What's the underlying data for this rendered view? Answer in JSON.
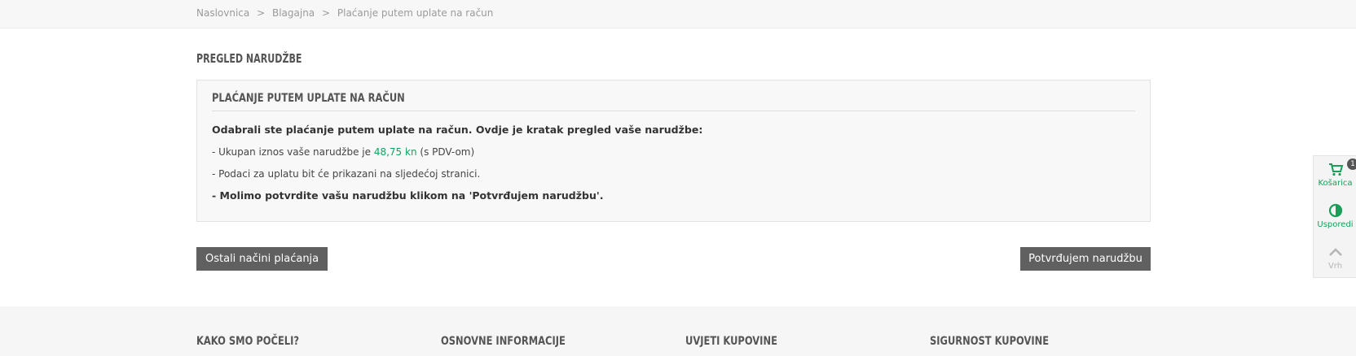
{
  "breadcrumb": {
    "items": [
      "Naslovnica",
      "Blagajna",
      "Plaćanje putem uplate na račun"
    ],
    "separator": ">"
  },
  "page": {
    "heading": "PREGLED NARUDŽBE"
  },
  "panel": {
    "title": "PLAĆANJE PUTEM UPLATE NA RAČUN",
    "intro": "Odabrali ste plaćanje putem uplate na račun. Ovdje je kratak pregled vaše narudžbe:",
    "total_prefix": "- Ukupan iznos vaše narudžbe je",
    "total_amount": "48,75 kn",
    "total_suffix": "(s PDV-om)",
    "info_line": "- Podaci za uplatu bit će prikazani na sljedećoj stranici.",
    "confirm_line": "- Molimo potvrdite vašu narudžbu klikom na 'Potvrđujem narudžbu'."
  },
  "buttons": {
    "other_methods": "Ostali načini plaćanja",
    "confirm": "Potvrđujem narudžbu"
  },
  "footer": {
    "columns": [
      "KAKO SMO POČELI?",
      "OSNOVNE INFORMACIJE",
      "UVJETI KUPOVINE",
      "SIGURNOST KUPOVINE"
    ]
  },
  "side_widget": {
    "cart_label": "Košarica",
    "cart_count": "1",
    "compare_label": "Usporedi",
    "top_label": "Vrh"
  },
  "colors": {
    "accent_green": "#1a9e5a",
    "button_gray": "#606060"
  },
  "icons": {
    "cart": "cart-icon",
    "compare": "compare-icon",
    "top": "chevron-up-icon"
  }
}
